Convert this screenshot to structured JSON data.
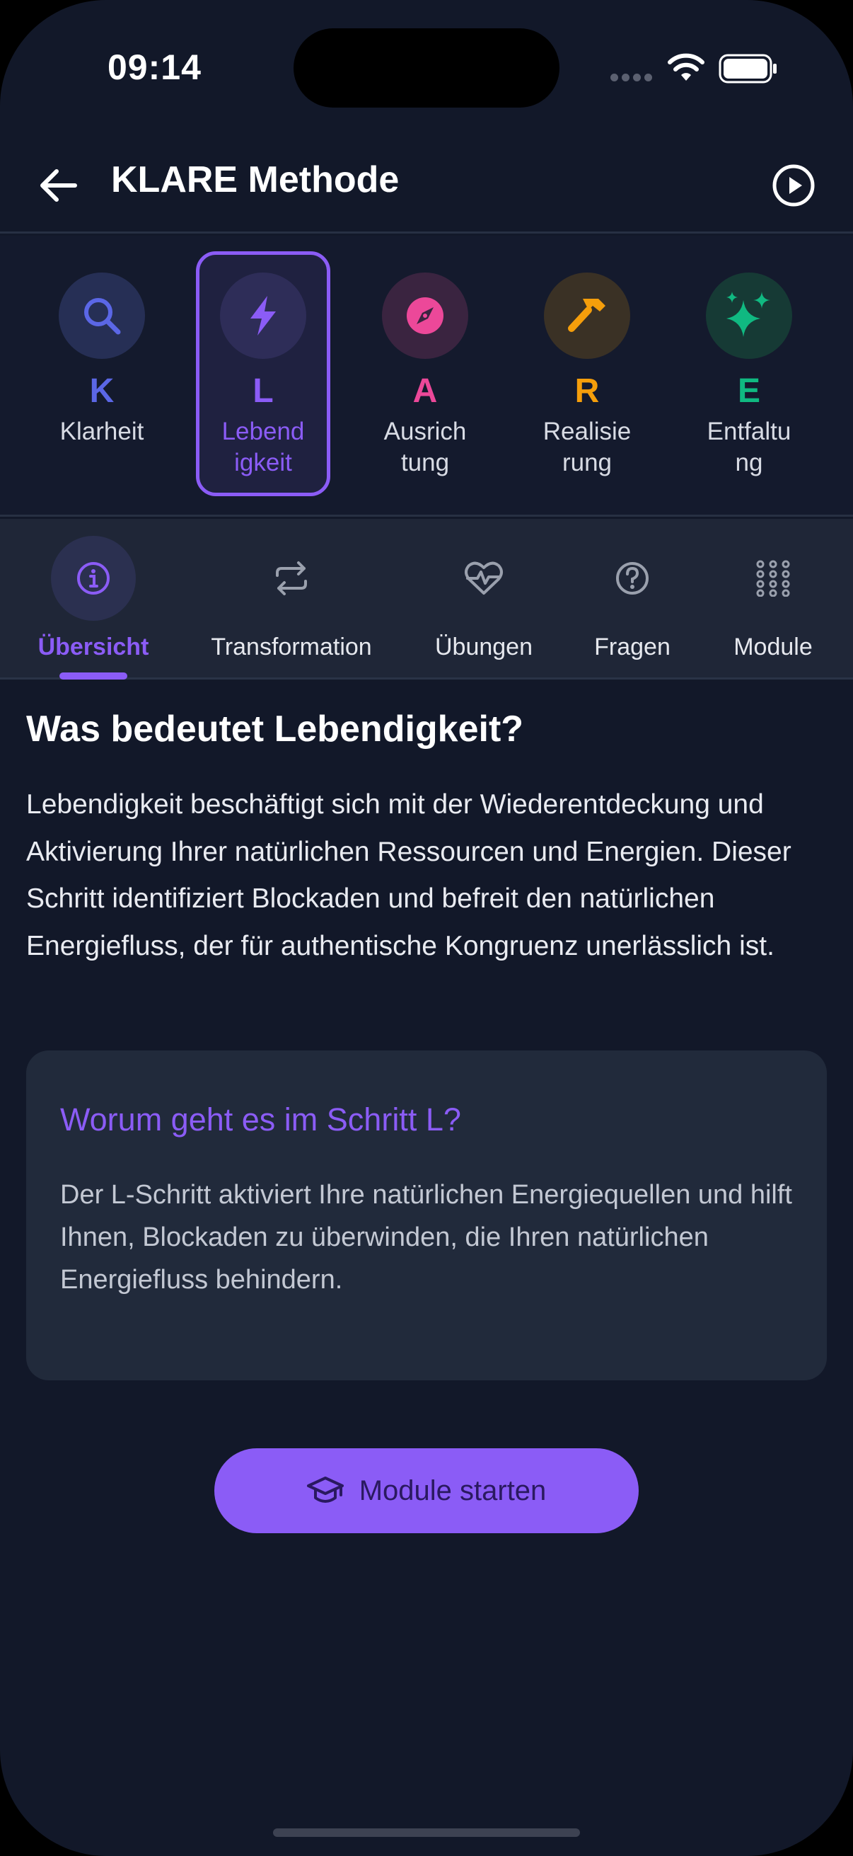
{
  "status_bar": {
    "time": "09:14"
  },
  "header": {
    "title": "KLARE Methode"
  },
  "steps": [
    {
      "letter": "K",
      "name": "Klarheit",
      "color": "#5b67e6",
      "bg": "#262f55",
      "icon": "search-icon"
    },
    {
      "letter": "L",
      "name": "Lebend\nigkeit",
      "color": "#8b5cf6",
      "bg": "#2e2d58",
      "icon": "lightning-icon",
      "active": true
    },
    {
      "letter": "A",
      "name": "Ausrich\ntung",
      "color": "#ec4899",
      "bg": "#3a2440",
      "icon": "compass-icon"
    },
    {
      "letter": "R",
      "name": "Realisie\nrung",
      "color": "#f59e0b",
      "bg": "#3a3125",
      "icon": "hammer-icon"
    },
    {
      "letter": "E",
      "name": "Entfaltu\nng",
      "color": "#10b981",
      "bg": "#163a35",
      "icon": "sparkles-icon"
    }
  ],
  "tabs": [
    {
      "label": "Übersicht",
      "icon": "info-icon",
      "active": true
    },
    {
      "label": "Transformation",
      "icon": "repeat-icon"
    },
    {
      "label": "Übungen",
      "icon": "heart-pulse-icon"
    },
    {
      "label": "Fragen",
      "icon": "question-icon"
    },
    {
      "label": "Module",
      "icon": "grid-icon"
    }
  ],
  "content": {
    "title": "Was bedeutet Lebendigkeit?",
    "body": "Lebendigkeit beschäftigt sich mit der Wiederentdeckung und Aktivierung Ihrer natürlichen Ressourcen und Energien. Dieser Schritt identifiziert Blockaden und befreit den natürlichen Energiefluss, der für authentische Kongruenz unerlässlich ist.",
    "card": {
      "title": "Worum geht es im Schritt L?",
      "text": "Der L-Schritt aktiviert Ihre natürlichen Energiequellen und hilft Ihnen, Blockaden zu überwinden, die Ihren natürlichen Energiefluss behindern."
    },
    "cta_label": "Module starten"
  },
  "colors": {
    "accent": "#8b5cf6",
    "background": "#121829",
    "card": "#212a3b"
  }
}
